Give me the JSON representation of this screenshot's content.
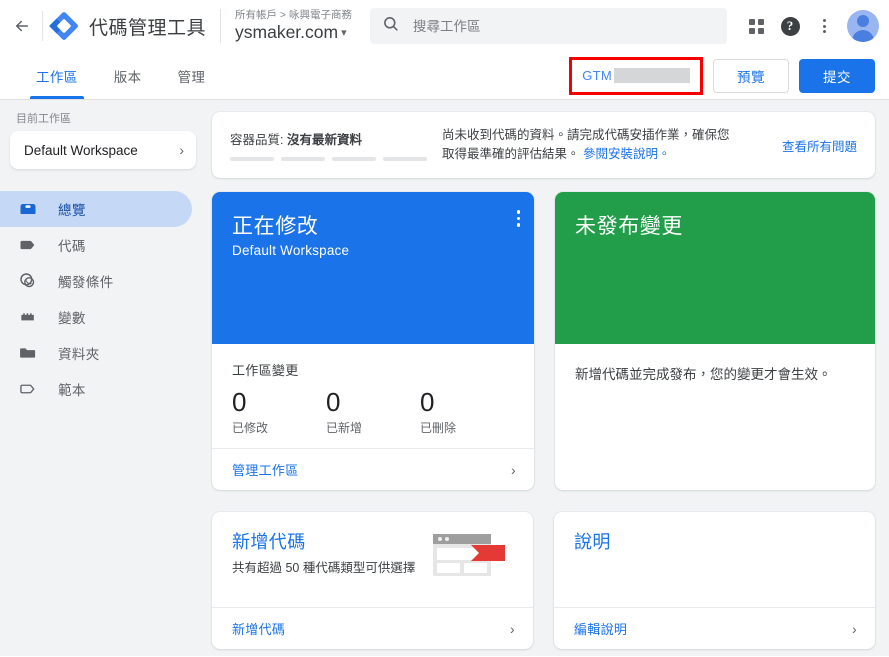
{
  "header": {
    "back_icon": "back-arrow-icon",
    "logo_icon": "gtm-diamond-logo",
    "app_title": "代碼管理工具",
    "account_breadcrumb": "所有帳戶 > 咏興電子商務",
    "container_name": "ysmaker.com",
    "container_caret": "▾",
    "search": {
      "icon": "search-icon",
      "placeholder": "搜尋工作區",
      "value": ""
    },
    "apps_icon": "apps-grid-icon",
    "help_icon": "help-circle-icon",
    "help_glyph": "?",
    "more_icon": "more-vertical-icon",
    "avatar_icon": "user-avatar"
  },
  "tabs": [
    {
      "label": "工作區",
      "active": true
    },
    {
      "label": "版本",
      "active": false
    },
    {
      "label": "管理",
      "active": false
    }
  ],
  "tab_actions": {
    "gtm_label": "GTM",
    "gtm_redacted": true,
    "highlight_color": "#f40000",
    "preview_label": "預覽",
    "submit_label": "提交"
  },
  "sidebar": {
    "workspace_label": "目前工作區",
    "workspace_name": "Default Workspace",
    "workspace_chevron": "›",
    "items": [
      {
        "label": "總覽",
        "icon": "overview-box-icon",
        "active": true
      },
      {
        "label": "代碼",
        "icon": "tag-icon",
        "active": false
      },
      {
        "label": "觸發條件",
        "icon": "trigger-circle-icon",
        "active": false
      },
      {
        "label": "變數",
        "icon": "variables-icon",
        "active": false
      },
      {
        "label": "資料夾",
        "icon": "folder-icon",
        "active": false
      },
      {
        "label": "範本",
        "icon": "template-tag-icon",
        "active": false
      }
    ]
  },
  "banner": {
    "quality_prefix": "容器品質: ",
    "quality_value": "沒有最新資料",
    "segments": 4,
    "message_line1": "尚未收到代碼的資料。請完成代碼安插作業，確保您",
    "message_line2": "取得最準確的評估結果。 ",
    "message_link": "參閱安裝說明。",
    "action_link": "查看所有問題"
  },
  "cards": {
    "workspace": {
      "hero_title": "正在修改",
      "hero_subtitle": "Default Workspace",
      "menu_icon": "more-vertical-icon",
      "hero_color": "#1a73e8",
      "stats_label": "工作區變更",
      "stats": [
        {
          "value": "0",
          "label": "已修改"
        },
        {
          "value": "0",
          "label": "已新增"
        },
        {
          "value": "0",
          "label": "已刪除"
        }
      ],
      "footer_label": "管理工作區",
      "footer_chevron": "›"
    },
    "unpublished": {
      "hero_title": "未發布變更",
      "hero_color": "#229e4a",
      "body_text": "新增代碼並完成發布，您的變更才會生效。"
    },
    "new_tag": {
      "title": "新增代碼",
      "description": "共有超過 50 種代碼類型可供選擇",
      "illustration_icon": "browser-tag-illustration",
      "footer_label": "新增代碼",
      "footer_chevron": "›"
    },
    "notes": {
      "title": "說明",
      "footer_label": "編輯說明",
      "footer_chevron": "›"
    }
  }
}
